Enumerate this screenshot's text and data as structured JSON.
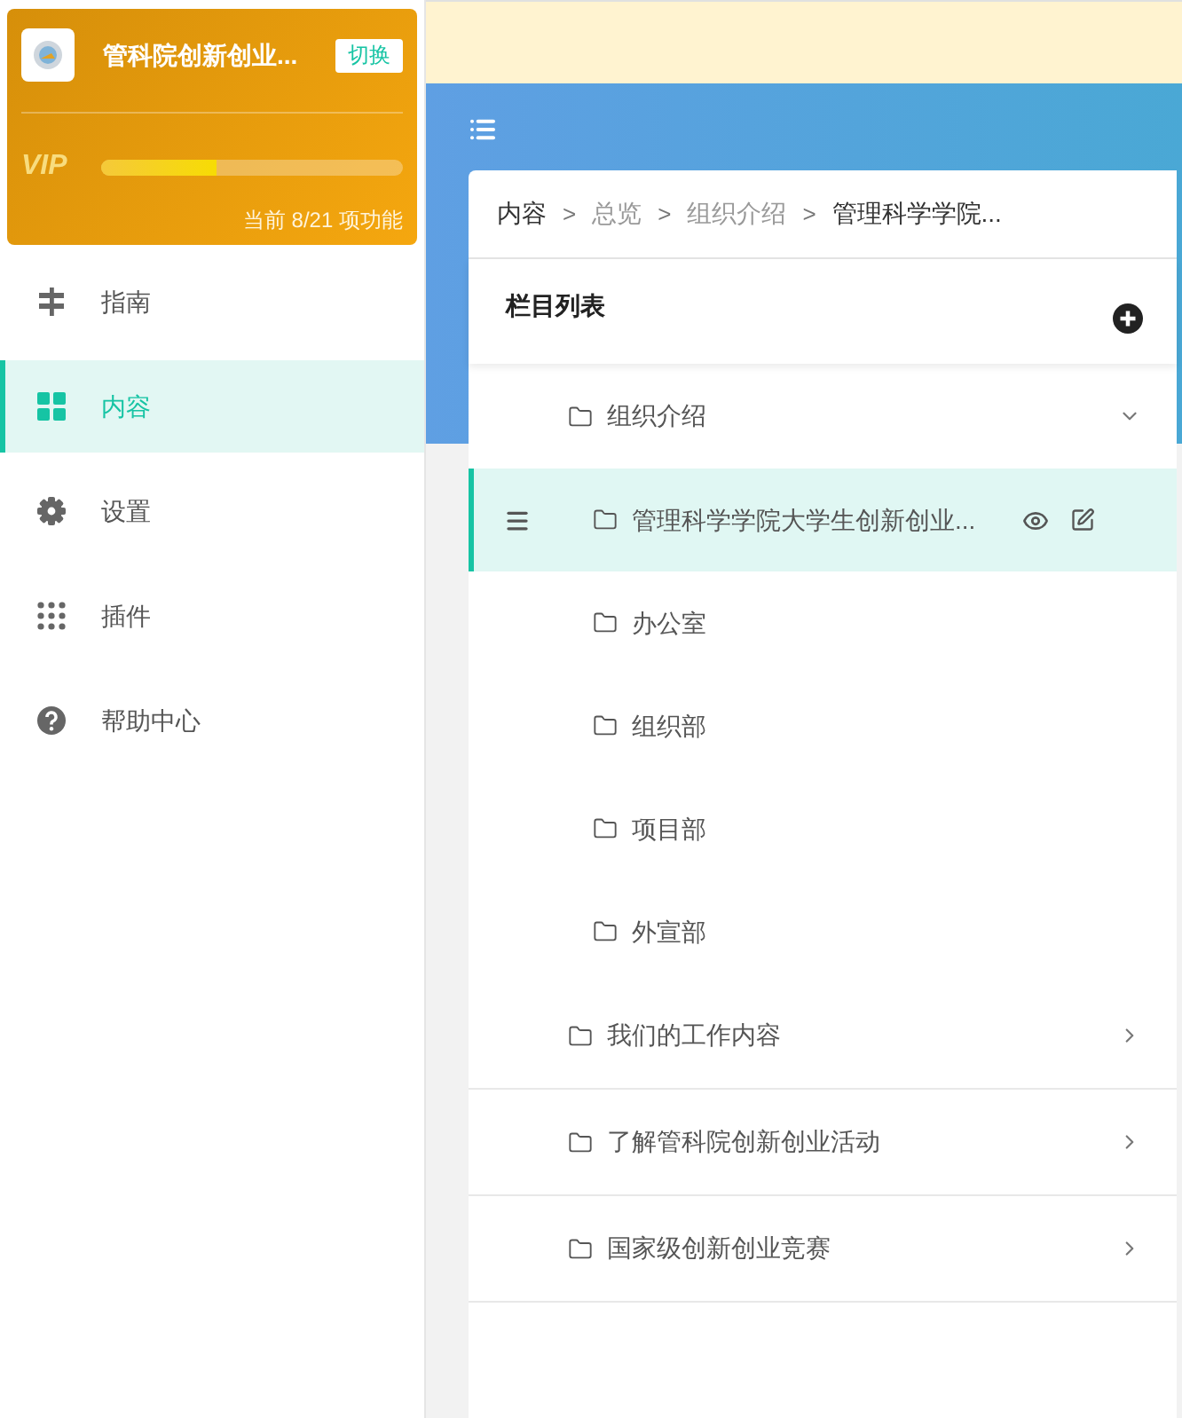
{
  "site": {
    "name": "管科院创新创业...",
    "switch_label": "切换",
    "vip_label": "VIP",
    "level": 0.38,
    "quota": "当前 8/21 项功能"
  },
  "nav": [
    {
      "kind": "guide",
      "label": "指南",
      "selected": false
    },
    {
      "kind": "content",
      "label": "内容",
      "selected": true
    },
    {
      "kind": "settings",
      "label": "设置",
      "selected": false
    },
    {
      "kind": "plugins",
      "label": "插件",
      "selected": false
    },
    {
      "kind": "help",
      "label": "帮助中心",
      "selected": false
    }
  ],
  "breadcrumb": [
    {
      "label": "内容",
      "muted": false
    },
    {
      "label": "总览",
      "muted": true
    },
    {
      "label": "组织介绍",
      "muted": true
    },
    {
      "label": "管理科学学院...",
      "muted": false
    }
  ],
  "breadcrumb_separator": ">",
  "panel_title": "栏目列表",
  "tree": [
    {
      "label": "组织介绍",
      "expanded": true,
      "children": [
        {
          "label": "管理科学学院大学生创新创业...",
          "selected": true
        },
        {
          "label": "办公室",
          "selected": false
        },
        {
          "label": "组织部",
          "selected": false
        },
        {
          "label": "项目部",
          "selected": false
        },
        {
          "label": "外宣部",
          "selected": false
        }
      ]
    },
    {
      "label": "我们的工作内容",
      "expanded": false
    },
    {
      "label": "了解管科院创新创业活动",
      "expanded": false
    },
    {
      "label": "国家级创新创业竞赛",
      "expanded": false
    }
  ]
}
